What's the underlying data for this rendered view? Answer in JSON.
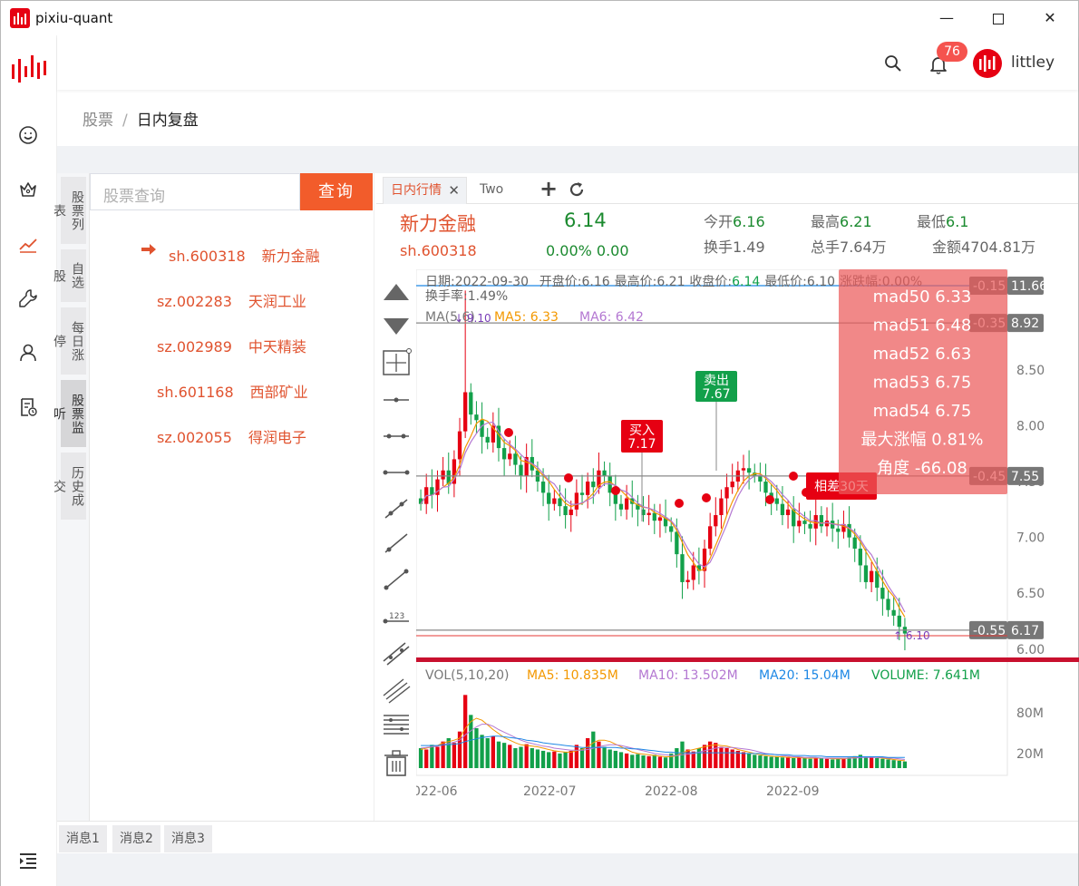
{
  "window": {
    "title": "pixiu-quant",
    "min": "—",
    "close": "✕"
  },
  "header": {
    "notification_count": "76",
    "username": "littley"
  },
  "breadcrumb": {
    "section": "股票",
    "separator": "/",
    "current": "日内复盘"
  },
  "vtabs": [
    {
      "label": "股票列表"
    },
    {
      "label": "自选股"
    },
    {
      "label": "每日涨停"
    },
    {
      "label": "股票监听"
    },
    {
      "label": "历史成交"
    }
  ],
  "search": {
    "placeholder": "股票查询",
    "button": "查询"
  },
  "stocks": [
    {
      "code": "sh.600318",
      "name": "新力金融"
    },
    {
      "code": "sz.002283",
      "name": "天润工业"
    },
    {
      "code": "sz.002989",
      "name": "中天精装"
    },
    {
      "code": "sh.601168",
      "name": "西部矿业"
    },
    {
      "code": "sz.002055",
      "name": "得润电子"
    }
  ],
  "tabs": {
    "active": "日内行情",
    "close": "✕",
    "second": "Two"
  },
  "quote": {
    "name": "新力金融",
    "price": "6.14",
    "code": "sh.600318",
    "change": "0.00% 0.00",
    "open_label": "今开",
    "open": "6.16",
    "high_label": "最高",
    "high": "6.21",
    "low_label": "最低",
    "low": "6.1",
    "turnover_label": "换手",
    "turnover": "1.49",
    "total_label": "总手",
    "total": "7.64万",
    "amount_label": "金额",
    "amount": "4704.81万"
  },
  "colors": {
    "accent": "#f25c2b",
    "up": "#e60012",
    "down": "#12a04a",
    "price_green": "#1b8a2f"
  },
  "chart_data": {
    "type": "candlestick",
    "info_line": [
      {
        "label": "日期:",
        "value": "2022-09-30"
      },
      {
        "label": "开盘价:",
        "value": "6.16"
      },
      {
        "label": "最高价:",
        "value": "6.21"
      },
      {
        "label": "收盘价:",
        "value": "6.14"
      },
      {
        "label": "最低价:",
        "value": "6.10"
      },
      {
        "label": "涨跌幅:",
        "value": "0.00%"
      }
    ],
    "turnover_line": "换手率:1.49%",
    "ma_legend": {
      "title": "MA(5,6)",
      "ma5": "MA5: 6.33",
      "ma6": "MA6: 6.42"
    },
    "vol_legend": {
      "title": "VOL(5,10,20)",
      "ma5": "MA5: 10.835M",
      "ma10": "MA10: 13.502M",
      "ma20": "MA20: 15.04M",
      "volume": "VOLUME: 7.641M"
    },
    "price_ticks": [
      "8.50",
      "8.00",
      "7.50",
      "7.00",
      "6.50",
      "6.00"
    ],
    "price_tick_values": [
      8.5,
      8.0,
      7.5,
      7.0,
      6.5,
      6.0
    ],
    "vol_ticks": [
      "80M",
      "20M"
    ],
    "x_ticks": [
      "022-06",
      "2022-07",
      "2022-08",
      "2022-09"
    ],
    "ylim": [
      5.95,
      9.4
    ],
    "high_marker": "9.10",
    "low_marker": "6.10",
    "buy": {
      "label": "买入",
      "price": "7.17"
    },
    "sell": {
      "label": "卖出",
      "price": "7.67"
    },
    "diff_label": "相差30天",
    "price_lines": [
      {
        "value": 11.66,
        "diff": "-0.15",
        "label": "11.66"
      },
      {
        "value": 8.92,
        "diff": "-0.35",
        "label": "8.92"
      },
      {
        "value": 7.55,
        "diff": "-0.45",
        "label": "7.55"
      },
      {
        "value": 6.17,
        "diff": "-0.55",
        "label": "6.17"
      }
    ],
    "stats_popup": [
      {
        "label": "mad50",
        "value": "6.33"
      },
      {
        "label": "mad51",
        "value": "6.48"
      },
      {
        "label": "mad52",
        "value": "6.63"
      },
      {
        "label": "mad53",
        "value": "6.75"
      },
      {
        "label": "mad54",
        "value": "6.75"
      },
      {
        "label": "最大涨幅",
        "value": "0.81%"
      },
      {
        "label": "角度",
        "value": "-66.08"
      }
    ],
    "closes": [
      7.3,
      7.45,
      7.38,
      7.52,
      7.6,
      7.48,
      7.7,
      7.95,
      8.3,
      8.1,
      8.05,
      7.9,
      7.85,
      8.0,
      7.8,
      7.7,
      7.75,
      7.65,
      7.55,
      7.72,
      7.6,
      7.5,
      7.4,
      7.3,
      7.35,
      7.28,
      7.2,
      7.25,
      7.4,
      7.38,
      7.5,
      7.45,
      7.6,
      7.55,
      7.4,
      7.3,
      7.25,
      7.35,
      7.3,
      7.25,
      7.2,
      7.22,
      7.15,
      7.18,
      7.1,
      7.05,
      6.85,
      6.6,
      6.62,
      6.75,
      6.7,
      6.9,
      7.1,
      7.2,
      7.35,
      7.45,
      7.5,
      7.6,
      7.62,
      7.58,
      7.55,
      7.5,
      7.4,
      7.35,
      7.3,
      7.2,
      7.25,
      7.1,
      7.15,
      7.12,
      7.08,
      7.2,
      7.1,
      7.15,
      7.08,
      7.05,
      7.12,
      7.0,
      6.9,
      6.75,
      6.6,
      6.7,
      6.55,
      6.45,
      6.35,
      6.3,
      6.2,
      6.14
    ],
    "volumes": [
      30,
      28,
      35,
      32,
      40,
      45,
      38,
      55,
      110,
      80,
      60,
      50,
      45,
      48,
      40,
      38,
      35,
      30,
      32,
      36,
      30,
      28,
      26,
      24,
      25,
      22,
      24,
      26,
      35,
      30,
      45,
      55,
      40,
      32,
      28,
      26,
      24,
      22,
      20,
      21,
      19,
      18,
      20,
      17,
      16,
      22,
      30,
      40,
      28,
      25,
      30,
      35,
      40,
      38,
      32,
      30,
      28,
      26,
      24,
      22,
      20,
      19,
      18,
      17,
      18,
      16,
      17,
      15,
      16,
      15,
      14,
      16,
      15,
      14,
      13,
      14,
      15,
      16,
      18,
      20,
      17,
      16,
      15,
      14,
      13,
      12,
      11,
      10
    ],
    "ma5_vol": [
      28,
      30,
      32,
      34,
      38,
      40,
      42,
      45,
      60,
      70,
      75,
      72,
      65,
      58,
      52,
      46,
      42,
      38,
      35,
      34,
      33,
      32,
      30,
      28,
      26,
      25,
      24,
      24,
      26,
      28,
      32,
      38,
      42,
      42,
      40,
      36,
      32,
      28,
      24,
      22,
      21,
      20,
      19,
      18,
      17,
      17,
      19,
      23,
      26,
      28,
      30,
      32,
      34,
      35,
      34,
      33,
      31,
      28,
      26,
      24,
      22,
      20,
      19,
      18,
      17,
      17,
      16,
      16,
      16,
      15,
      15,
      15,
      15,
      15,
      14,
      14,
      14,
      15,
      16,
      17,
      17,
      17,
      16,
      15,
      14,
      13,
      12,
      11
    ],
    "ma10_vol": [
      30,
      31,
      32,
      33,
      35,
      37,
      39,
      42,
      50,
      56,
      62,
      66,
      66,
      63,
      58,
      54,
      50,
      46,
      42,
      39,
      37,
      35,
      33,
      32,
      30,
      29,
      28,
      27,
      27,
      27,
      28,
      30,
      32,
      34,
      35,
      35,
      34,
      32,
      30,
      28,
      26,
      24,
      22,
      21,
      20,
      19,
      19,
      20,
      21,
      22,
      24,
      26,
      28,
      30,
      31,
      31,
      31,
      30,
      29,
      28,
      26,
      24,
      22,
      21,
      20,
      19,
      18,
      17,
      17,
      16,
      16,
      16,
      15,
      15,
      15,
      15,
      15,
      15,
      15,
      16,
      16,
      16,
      16,
      16,
      15,
      15,
      14,
      13
    ],
    "ma20_vol": [
      34,
      34,
      34,
      34,
      35,
      35,
      36,
      37,
      40,
      42,
      44,
      46,
      47,
      48,
      48,
      47,
      46,
      45,
      44,
      42,
      41,
      40,
      38,
      37,
      36,
      35,
      34,
      33,
      32,
      31,
      31,
      31,
      31,
      31,
      31,
      31,
      30,
      30,
      29,
      29,
      28,
      27,
      26,
      25,
      24,
      24,
      23,
      23,
      23,
      23,
      23,
      23,
      23,
      23,
      23,
      23,
      23,
      23,
      22,
      22,
      22,
      22,
      21,
      21,
      20,
      20,
      20,
      19,
      19,
      19,
      18,
      18,
      18,
      17,
      17,
      17,
      17,
      17,
      17,
      17,
      17,
      17,
      17,
      17,
      16,
      16,
      16,
      16
    ]
  },
  "messages": [
    "消息1",
    "消息2",
    "消息3"
  ]
}
